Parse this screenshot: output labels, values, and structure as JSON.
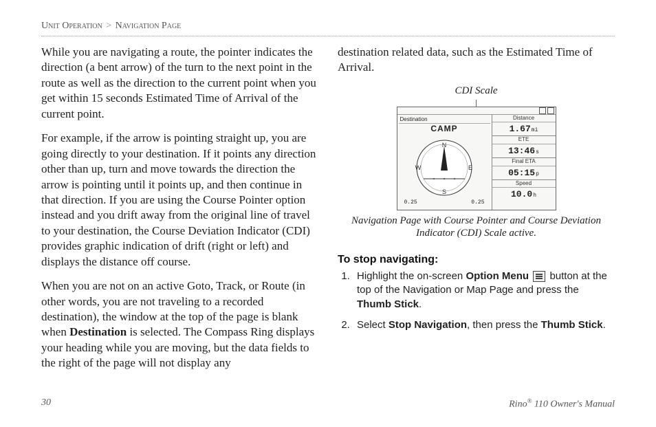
{
  "breadcrumb": {
    "section": "Unit Operation",
    "page": "Navigation Page",
    "sep": ">"
  },
  "left": {
    "p1": "While you are navigating a route, the pointer indicates the direction (a bent arrow) of the turn to the next point in the route as well as the direction to the current point when you get within 15 seconds Estimated Time of Arrival of the current point.",
    "p2": "For example, if the arrow is pointing straight up, you are going directly to your destination. If it points any direction other than up, turn and move towards the direction the arrow is pointing until it points up, and then continue in that direction. If you are using the Course Pointer option instead and you drift away from the original line of travel to your destination, the Course Deviation Indicator (CDI) provides graphic indication of drift (right or left) and displays the distance off course.",
    "p3a": "When you are not on an active Goto, Track, or Route (in other words, you are not traveling to a recorded destination), the window at the top of the page is blank when ",
    "p3b_bold": "Destination",
    "p3c": " is selected. The Compass Ring displays your heading while you are moving, but the data fields to the right of the page will not display any"
  },
  "right": {
    "continuation": "destination related data, such as the Estimated Time of Arrival.",
    "cdi_label": "CDI Scale",
    "device": {
      "dest_hdr": "Destination",
      "dest_val": "CAMP",
      "fields": [
        {
          "hdr": "Distance",
          "val": "1.67",
          "unit": "mi"
        },
        {
          "hdr": "ETE",
          "val": "13:46",
          "unit": "s"
        },
        {
          "hdr": "Final ETA",
          "val": "05:15",
          "unit": "p"
        },
        {
          "hdr": "Speed",
          "val": "10.0",
          "unit": "h"
        }
      ],
      "scale_left": "0.25",
      "scale_right": "0.25"
    },
    "caption": "Navigation Page with Course Pointer and Course Deviation Indicator (CDI) Scale active.",
    "stop_head": "To stop navigating:",
    "step1_a": "Highlight the on-screen ",
    "step1_b_bold": "Option Menu",
    "step1_c": " button at the top of the Navigation or Map Page and press the ",
    "step1_d_bold": "Thumb Stick",
    "step1_e": ".",
    "step2_a": "Select ",
    "step2_b_bold": "Stop Navigation",
    "step2_c": ", then press the ",
    "step2_d_bold": "Thumb Stick",
    "step2_e": "."
  },
  "footer": {
    "page_num": "30",
    "product_a": "Rino",
    "product_sup": "®",
    "product_b": " 110 Owner's Manual"
  }
}
